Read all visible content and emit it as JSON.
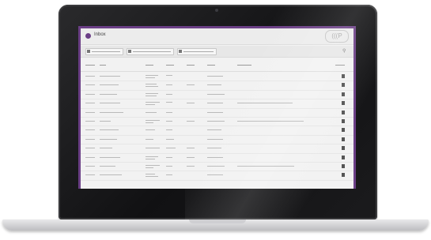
{
  "app": {
    "title": "Inbox",
    "brand": "(((P"
  },
  "colors": {
    "accent": "#6b3f86",
    "background": "#f2f2f2"
  },
  "icons": {
    "logo": "app-logo-icon",
    "search": "search-icon",
    "edit": "edit-icon"
  }
}
